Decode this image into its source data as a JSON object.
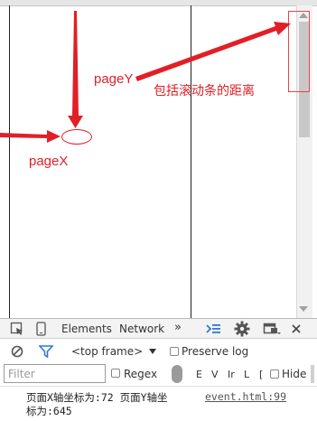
{
  "annotations": {
    "pagex_label": "pageX",
    "pagey_label": "pageY",
    "pagey_note": "包括滚动条的距离"
  },
  "devtools": {
    "tabs": [
      {
        "label": "Elements"
      },
      {
        "label": "Network"
      }
    ],
    "more_tabs": "»",
    "toolbar": {
      "frame_selector": "<top frame>",
      "preserve_log": "Preserve log"
    },
    "filterbar": {
      "filter_placeholder": "Filter",
      "regex": "Regex",
      "level_letters": [
        "E",
        "V",
        "Ir",
        "L",
        "["
      ],
      "hide": "Hide"
    },
    "console": {
      "line1": "页面X轴坐标为:72 页面Y轴坐",
      "line2": "标为:645",
      "source_link": "event.html:99"
    }
  },
  "colors": {
    "annotation_red": "#e21f26",
    "devtools_blue": "#2f7ad6"
  }
}
